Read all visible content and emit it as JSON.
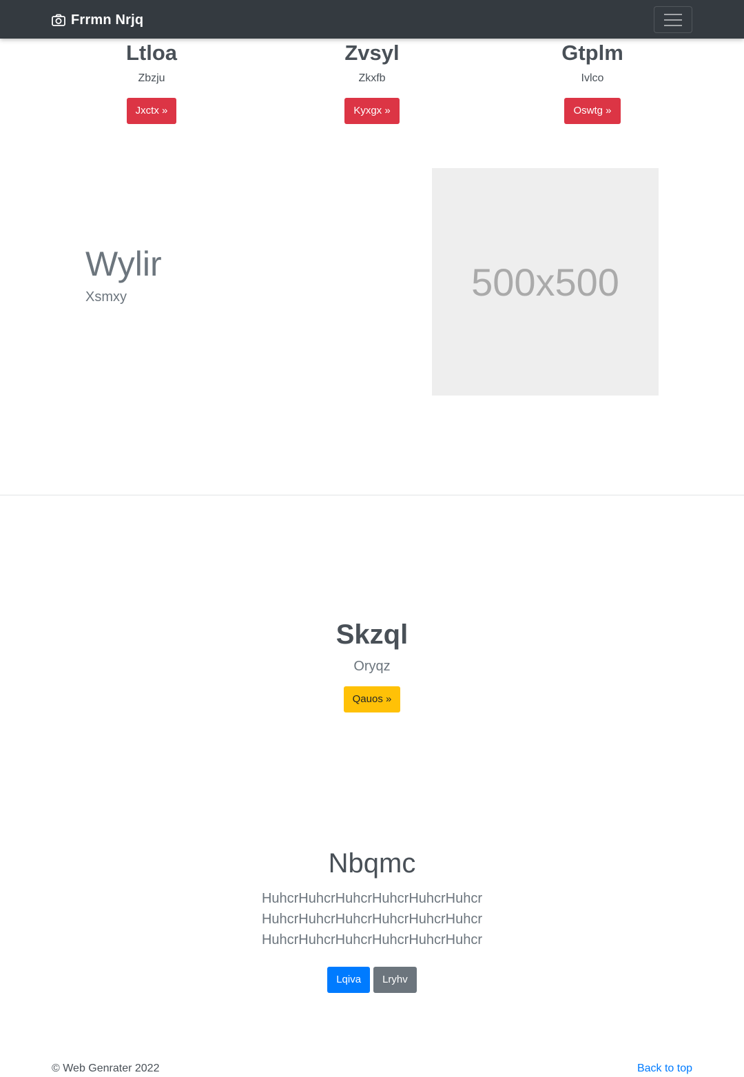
{
  "navbar": {
    "brand_icon": "camera-icon",
    "brand_text": "Frrmn Nrjq",
    "toggler_icon": "hamburger-menu-icon"
  },
  "features": [
    {
      "title": "Ltloa",
      "subtitle": "Zbzju",
      "button": "Jxctx »"
    },
    {
      "title": "Zvsyl",
      "subtitle": "Zkxfb",
      "button": "Kyxgx »"
    },
    {
      "title": "Gtplm",
      "subtitle": "Ivlco",
      "button": "Oswtg »"
    }
  ],
  "hero": {
    "title": "Wylir",
    "subtitle": "Xsmxy",
    "placeholder_text": "500x500"
  },
  "cta": {
    "title": "Skzql",
    "subtitle": "Oryqz",
    "button": "Qauos »"
  },
  "jumbotron": {
    "title": "Nbqmc",
    "lines": [
      "HuhcrHuhcrHuhcrHuhcrHuhcrHuhcr",
      "HuhcrHuhcrHuhcrHuhcrHuhcrHuhcr",
      "HuhcrHuhcrHuhcrHuhcrHuhcrHuhcr"
    ],
    "primary_button": "Lqiva",
    "secondary_button": "Lryhv"
  },
  "footer": {
    "copyright": "© Web Genrater 2022",
    "back_to_top": "Back to top"
  },
  "colors": {
    "navbar_bg": "#343a40",
    "danger": "#dc3545",
    "warning": "#ffc107",
    "primary": "#007bff",
    "secondary": "#6c757d"
  }
}
